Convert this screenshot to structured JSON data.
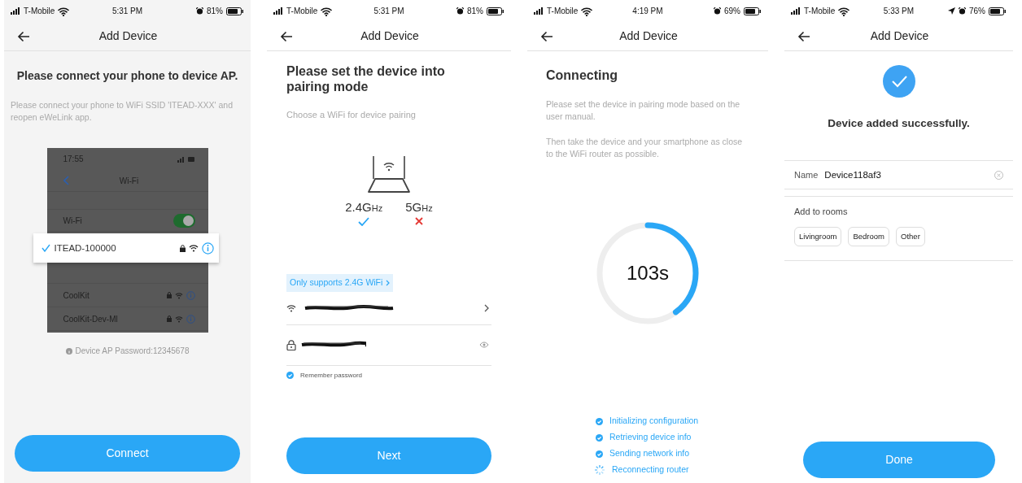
{
  "screens": [
    {
      "kind": "connect_ap",
      "status_bar": {
        "carrier": "T-Mobile",
        "time": "5:31 PM",
        "battery": "81%"
      },
      "title": "Add Device",
      "heading": "Please connect your phone to device AP.",
      "description": "Please connect your phone to WiFi SSID 'ITEAD-XXX' and reopen eWeLink app.",
      "guide": {
        "time": "17:55",
        "title": "Wi-Fi",
        "toggle_label": "Wi-Fi",
        "toggle_on": true,
        "selected_network": "ITEAD-100000",
        "networks": [
          "CoolKit",
          "CoolKit-Dev-Ml"
        ]
      },
      "password_note": "Device AP Password:12345678",
      "button": "Connect"
    },
    {
      "kind": "pairing",
      "status_bar": {
        "carrier": "T-Mobile",
        "time": "5:31 PM",
        "battery": "81%"
      },
      "title": "Add Device",
      "heading": "Please set the device into pairing mode",
      "description": "Choose a WiFi for device pairing",
      "bands": [
        {
          "label": "2.4G",
          "unit": "Hz",
          "supported": true
        },
        {
          "label": "5G",
          "unit": "Hz",
          "supported": false
        }
      ],
      "notice": "Only supports 2.4G WiFi",
      "remember_password": {
        "label": "Remember password",
        "checked": true
      },
      "button": "Next"
    },
    {
      "kind": "connecting",
      "status_bar": {
        "carrier": "T-Mobile",
        "time": "4:19 PM",
        "battery": "69%"
      },
      "title": "Add Device",
      "heading": "Connecting",
      "paragraphs": [
        "Please set the device in pairing mode based on the user manual.",
        "Then take the device and your smartphone as close to the WiFi router as possible."
      ],
      "progress": {
        "level": 0.4,
        "reading": "103s"
      },
      "steps": [
        {
          "label": "Initializing configuration",
          "done": true
        },
        {
          "label": "Retrieving device info",
          "done": true
        },
        {
          "label": "Sending network info",
          "done": true
        },
        {
          "label": "Reconnecting router",
          "done": false
        }
      ]
    },
    {
      "kind": "success",
      "status_bar": {
        "carrier": "T-Mobile",
        "time": "5:33 PM",
        "battery": "76%",
        "location": true
      },
      "title": "Add Device",
      "message": "Device added successfully.",
      "name_field": {
        "label": "Name",
        "value": "Device118af3"
      },
      "rooms": {
        "label": "Add to rooms",
        "options": [
          {
            "label": "Livingroom",
            "selected": false
          },
          {
            "label": "Bedroom",
            "selected": false
          },
          {
            "label": "Other",
            "selected": false
          }
        ]
      },
      "button": "Done"
    }
  ]
}
